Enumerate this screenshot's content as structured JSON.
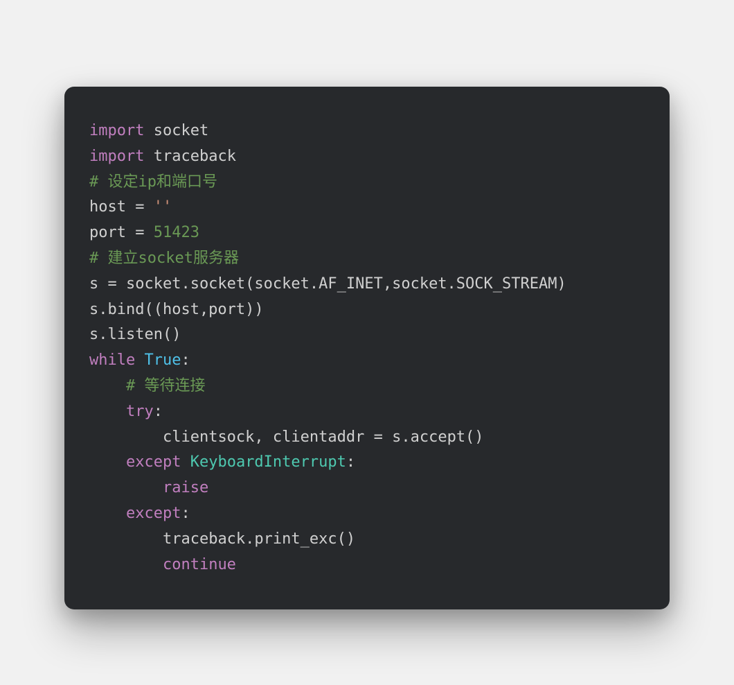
{
  "code": {
    "lines": [
      {
        "indent": 0,
        "tokens": [
          {
            "cls": "kw",
            "text": "import"
          },
          {
            "cls": "id",
            "text": " socket"
          }
        ]
      },
      {
        "indent": 0,
        "tokens": [
          {
            "cls": "kw",
            "text": "import"
          },
          {
            "cls": "id",
            "text": " traceback"
          }
        ]
      },
      {
        "indent": 0,
        "tokens": [
          {
            "cls": "cm",
            "text": "# 设定ip和端口号"
          }
        ]
      },
      {
        "indent": 0,
        "tokens": [
          {
            "cls": "id",
            "text": "host = "
          },
          {
            "cls": "str",
            "text": "''"
          }
        ]
      },
      {
        "indent": 0,
        "tokens": [
          {
            "cls": "id",
            "text": "port = "
          },
          {
            "cls": "num",
            "text": "51423"
          }
        ]
      },
      {
        "indent": 0,
        "tokens": [
          {
            "cls": "cm",
            "text": "# 建立socket服务器"
          }
        ]
      },
      {
        "indent": 0,
        "tokens": [
          {
            "cls": "id",
            "text": "s = socket.socket(socket.AF_INET,socket.SOCK_STREAM)"
          }
        ]
      },
      {
        "indent": 0,
        "tokens": [
          {
            "cls": "id",
            "text": "s.bind((host,port))"
          }
        ]
      },
      {
        "indent": 0,
        "tokens": [
          {
            "cls": "id",
            "text": "s.listen()"
          }
        ]
      },
      {
        "indent": 0,
        "tokens": [
          {
            "cls": "kw",
            "text": "while"
          },
          {
            "cls": "id",
            "text": " "
          },
          {
            "cls": "bool",
            "text": "True"
          },
          {
            "cls": "id",
            "text": ":"
          }
        ]
      },
      {
        "indent": 1,
        "tokens": [
          {
            "cls": "cm",
            "text": "# 等待连接"
          }
        ]
      },
      {
        "indent": 1,
        "tokens": [
          {
            "cls": "kw",
            "text": "try"
          },
          {
            "cls": "id",
            "text": ":"
          }
        ]
      },
      {
        "indent": 2,
        "tokens": [
          {
            "cls": "id",
            "text": "clientsock, clientaddr = s.accept()"
          }
        ]
      },
      {
        "indent": 1,
        "tokens": [
          {
            "cls": "kw",
            "text": "except"
          },
          {
            "cls": "id",
            "text": " "
          },
          {
            "cls": "cls",
            "text": "KeyboardInterrupt"
          },
          {
            "cls": "id",
            "text": ":"
          }
        ]
      },
      {
        "indent": 2,
        "tokens": [
          {
            "cls": "kw",
            "text": "raise"
          }
        ]
      },
      {
        "indent": 1,
        "tokens": [
          {
            "cls": "kw",
            "text": "except"
          },
          {
            "cls": "id",
            "text": ":"
          }
        ]
      },
      {
        "indent": 2,
        "tokens": [
          {
            "cls": "id",
            "text": "traceback.print_exc()"
          }
        ]
      },
      {
        "indent": 2,
        "tokens": [
          {
            "cls": "kw",
            "text": "continue"
          }
        ]
      }
    ],
    "indent_unit": "    "
  }
}
